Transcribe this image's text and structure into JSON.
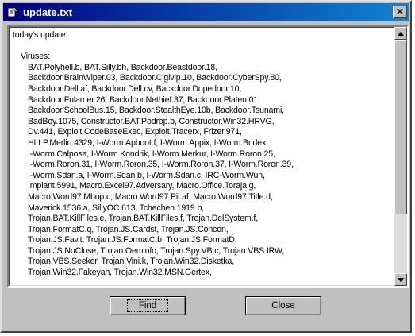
{
  "window": {
    "title": "update.txt",
    "close_glyph": "✕"
  },
  "content": {
    "header": "today's update:",
    "section": "Viruses:",
    "lines": [
      "BAT.Polyhell.b, BAT.Silly.bh, Backdoor.Beastdoor.18,",
      "Backdoor.BrainWiper.03, Backdoor.Cigivip.10, Backdoor.CyberSpy.80,",
      "Backdoor.Dell.af, Backdoor.Dell.cv, Backdoor.Dopedoor.10,",
      "Backdoor.Fulamer.26, Backdoor.Nethief.37, Backdoor.Platen.01,",
      "Backdoor.SchoolBus.15, Backdoor.StealthEye.10b, Backdoor.Tsunami,",
      "BadBoy.1075, Constructor.BAT.Podrop.b, Constructor.Win32.HRVG,",
      "Dv.441, Exploit.CodeBaseExec, Exploit.Tracerx, Frizer.971,",
      "HLLP.Merlin.4329, I-Worm.Apboot.f, I-Worm.Appix, I-Worm.Bridex,",
      "I-Worm.Calposa, I-Worm.Kondrik, I-Worm.Merkur, I-Worm.Roron.25,",
      "I-Worm.Roron.31, I-Worm.Roron.35, I-Worm.Roron.37, I-Worm.Roron.39,",
      "I-Worm.Sdan.a, I-Worm.Sdan.b, I-Worm.Sdan.c, IRC-Worm.Wun,",
      "Implant.5991, Macro.Excel97.Adversary, Macro.Office.Toraja.g,",
      "Macro.Word97.Mbop.c, Macro.Word97.Pii.af, Macro.Word97.Title.d,",
      "Maverick.1536.a, SillyOC.613, Tchechen.1919.b,",
      "Trojan.BAT.KillFiles.e, Trojan.BAT.KillFiles.f, Trojan.DelSystem.f,",
      "Trojan.FormatC.q, Trojan.JS.Cardst, Trojan.JS.Concon,",
      "Trojan.JS.Fav.t, Trojan.JS.FormatC.b, Trojan.JS.FormatD,",
      "Trojan.JS.NoClose, Trojan.Oeminfo, Trojan.Spy.VB.c, Trojan.VBS.IRW,",
      "Trojan.VBS.Seeker, Trojan.Vini.k, Trojan.Win32.Disketka,",
      "Trojan.Win32.Fakeyah, Trojan.Win32.MSN.Gertex,"
    ]
  },
  "buttons": {
    "find_label": "Find",
    "close_label": "Close"
  }
}
